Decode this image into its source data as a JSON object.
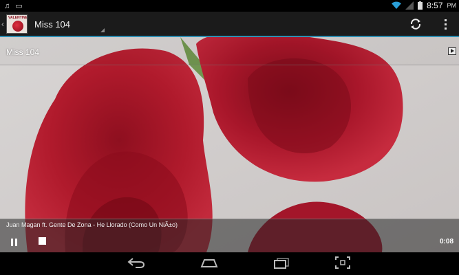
{
  "statusbar": {
    "time": "8:57",
    "ampm": "PM"
  },
  "actionbar": {
    "app_icon_text": "VALENTINE",
    "title": "Miss 104"
  },
  "video": {
    "title": "Miss 104"
  },
  "player": {
    "track": "Juan Magan ft. Gente De Zona -  He Llorado (Como Un NiÃ±o)",
    "elapsed": "0:08"
  },
  "colors": {
    "accent": "#2f8fb3",
    "rose": "#b2162b"
  }
}
